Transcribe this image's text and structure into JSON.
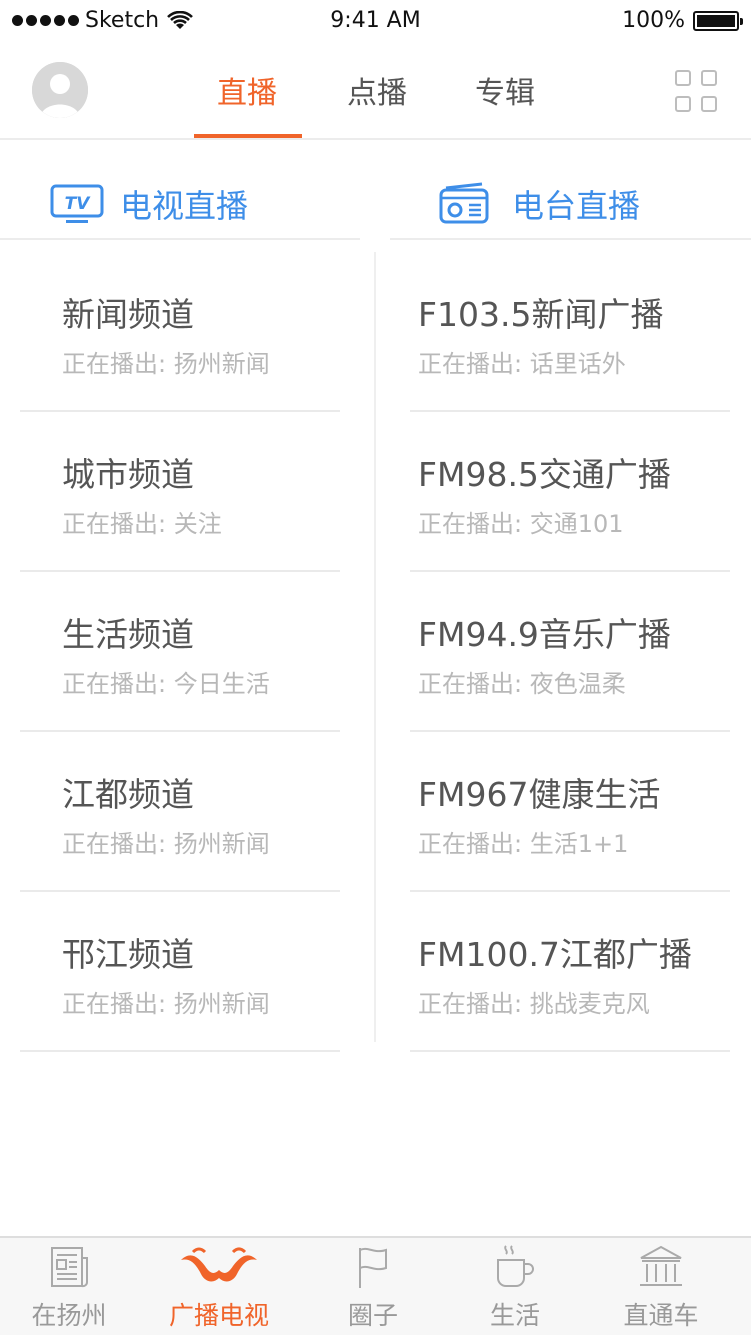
{
  "status_bar": {
    "carrier": "Sketch",
    "time": "9:41 AM",
    "battery": "100%"
  },
  "header": {
    "tabs": [
      {
        "label": "直播",
        "active": true
      },
      {
        "label": "点播",
        "active": false
      },
      {
        "label": "专辑",
        "active": false
      }
    ],
    "icons": [
      "user-avatar-icon",
      "grid-menu-icon"
    ]
  },
  "sections": {
    "tv": {
      "title": "电视直播",
      "icon": "tv-icon",
      "items": [
        {
          "name": "新闻频道",
          "now_playing": "正在播出: 扬州新闻"
        },
        {
          "name": "城市频道",
          "now_playing": "正在播出: 关注"
        },
        {
          "name": "生活频道",
          "now_playing": "正在播出: 今日生活"
        },
        {
          "name": "江都频道",
          "now_playing": "正在播出: 扬州新闻"
        },
        {
          "name": "邗江频道",
          "now_playing": "正在播出: 扬州新闻"
        }
      ]
    },
    "radio": {
      "title": "电台直播",
      "icon": "radio-icon",
      "items": [
        {
          "name": "F103.5新闻广播",
          "now_playing": "正在播出: 话里话外"
        },
        {
          "name": "FM98.5交通广播",
          "now_playing": "正在播出: 交通101"
        },
        {
          "name": "FM94.9音乐广播",
          "now_playing": "正在播出: 夜色温柔"
        },
        {
          "name": "FM967健康生活",
          "now_playing": "正在播出: 生活1+1"
        },
        {
          "name": "FM100.7江都广播",
          "now_playing": "正在播出: 挑战麦克风"
        }
      ]
    }
  },
  "tabbar": {
    "items": [
      {
        "label": "在扬州",
        "icon": "newspaper-icon",
        "active": false
      },
      {
        "label": "广播电视",
        "icon": "broadcast-icon",
        "active": true
      },
      {
        "label": "圈子",
        "icon": "flag-icon",
        "active": false
      },
      {
        "label": "生活",
        "icon": "coffee-cup-icon",
        "active": false
      },
      {
        "label": "直通车",
        "icon": "building-icon",
        "active": false
      }
    ]
  },
  "colors": {
    "accent": "#f0642a",
    "section_blue": "#3e8ee8",
    "primary_text": "#555555",
    "secondary_text": "#b8b8b8"
  }
}
